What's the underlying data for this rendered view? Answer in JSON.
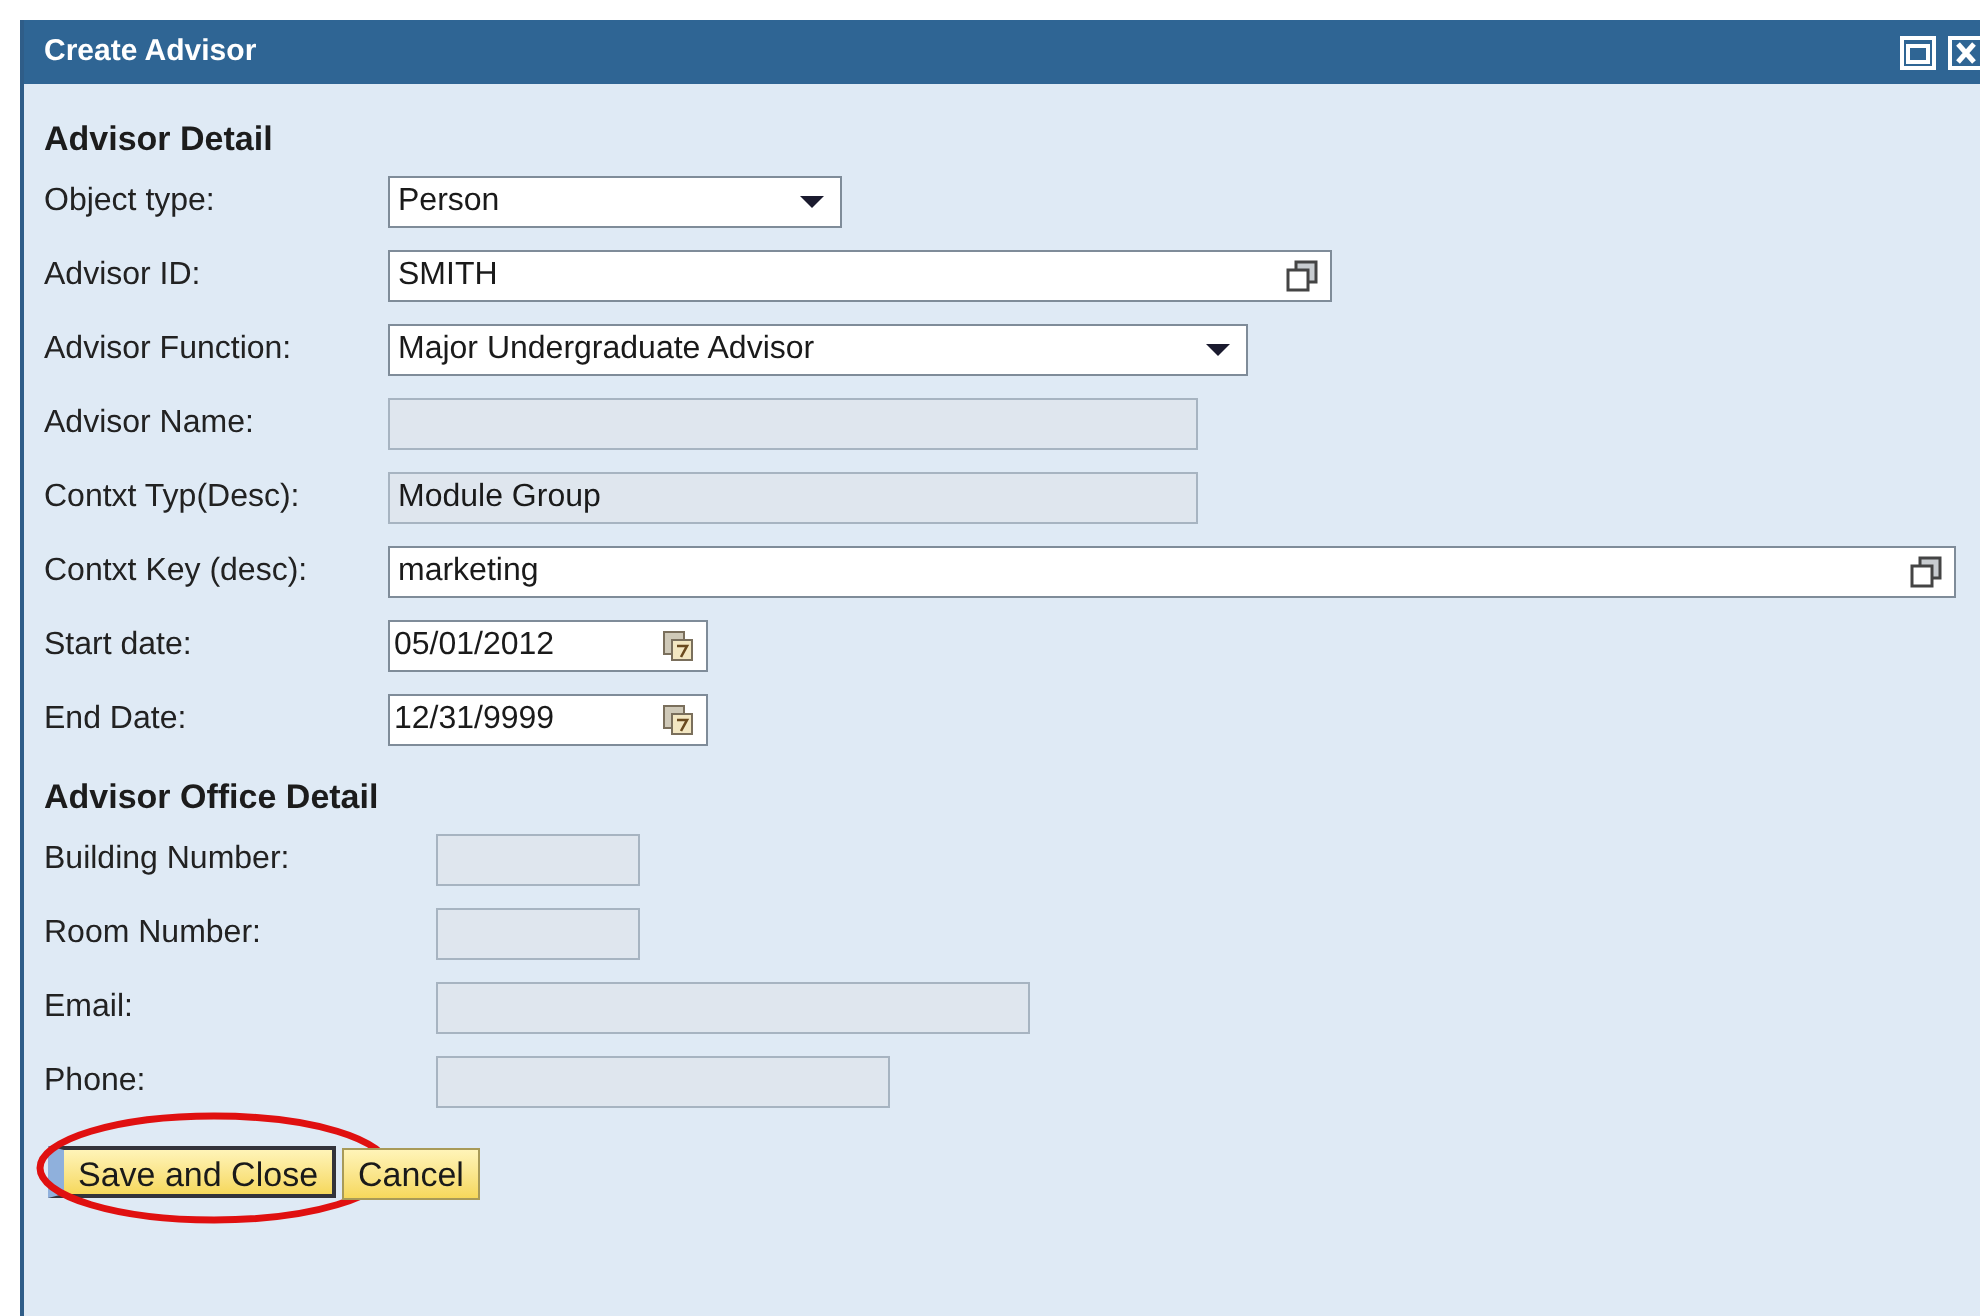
{
  "window": {
    "title": "Create Advisor"
  },
  "sections": [
    {
      "title": "Advisor Detail",
      "fields": [
        {
          "label": "Object type:",
          "kind": "dropdown",
          "value": "Person"
        },
        {
          "label": "Advisor ID:",
          "kind": "valuehelp",
          "value": "SMITH"
        },
        {
          "label": "Advisor Function:",
          "kind": "dropdown",
          "value": "Major Undergraduate Advisor"
        },
        {
          "label": "Advisor Name:",
          "kind": "readonly"
        },
        {
          "label": "Contxt Typ(Desc):",
          "kind": "readonly",
          "value": "Module Group"
        },
        {
          "label": "Contxt Key (desc):",
          "kind": "valuehelp",
          "value": "marketing"
        },
        {
          "label": "Start date:",
          "kind": "date",
          "value": "05/01/2012"
        },
        {
          "label": "End Date:",
          "kind": "date",
          "value": "12/31/9999"
        }
      ]
    },
    {
      "title": "Advisor Office Detail",
      "fields": [
        {
          "label": "Building Number:",
          "kind": "readonly"
        },
        {
          "label": "Room Number:",
          "kind": "readonly"
        },
        {
          "label": "Email:",
          "kind": "readonly"
        },
        {
          "label": "Phone:",
          "kind": "readonly"
        }
      ]
    }
  ],
  "buttons": [
    {
      "label": "Save and Close",
      "circled": true
    },
    {
      "label": "Cancel",
      "circled": false
    }
  ]
}
